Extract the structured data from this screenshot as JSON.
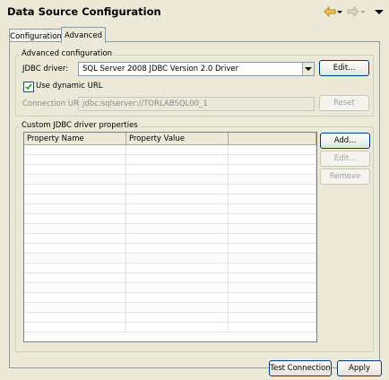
{
  "window": {
    "title": "Data Source Configuration"
  },
  "nav": {
    "back_icon": "back-arrow-icon",
    "forward_icon": "forward-arrow-icon",
    "menu_icon": "view-menu-icon"
  },
  "tabs": [
    {
      "label": "Configuration"
    },
    {
      "label": "Advanced"
    }
  ],
  "advanced": {
    "legend": "Advanced configuration",
    "jdbc_driver_label": "JDBC driver:",
    "jdbc_driver_value": "SQL Server 2008 JDBC Version 2.0 Driver",
    "edit_button": "Edit...",
    "dynamic_url_label": "Use dynamic URL",
    "dynamic_url_checked": true,
    "connection_url_label": "Connection URL:",
    "connection_url_value": "jdbc:sqlserver://TORLABSQL00_1",
    "reset_button": "Reset"
  },
  "custom": {
    "legend": "Custom JDBC driver properties",
    "columns": [
      "Property Name",
      "Property Value",
      ""
    ],
    "add_button": "Add...",
    "edit_button": "Edit...",
    "remove_button": "Remove"
  },
  "footer": {
    "test_connection": "Test Connection",
    "apply": "Apply"
  },
  "colors": {
    "background": "#ece9d8",
    "button_border": "#003c74",
    "disabled_text": "#a0a0a0"
  }
}
